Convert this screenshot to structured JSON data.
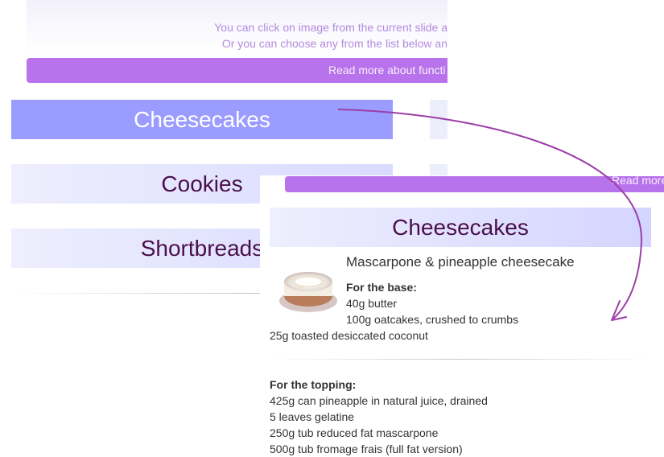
{
  "back_panel": {
    "intro_line1": "You can click on image from the current slide a",
    "intro_line2": "Or you can choose any from the list below an",
    "read_more": "Read more about functi",
    "categories": [
      "Cheesecakes",
      "Cookies",
      "Shortbreads"
    ]
  },
  "front_panel": {
    "read_more": "Read more abo",
    "category_title": "Cheesecakes",
    "recipe": {
      "title": "Mascarpone & pineapple cheesecake",
      "base_heading": "For the base:",
      "base_items": [
        "40g butter",
        "100g oatcakes, crushed to crumbs",
        "25g toasted desiccated coconut"
      ],
      "topping_heading": "For the topping:",
      "topping_items": [
        "425g can pineapple in natural juice, drained",
        "5 leaves gelatine",
        "250g tub reduced fat mascarpone",
        "500g tub fromage frais (full fat version)"
      ]
    }
  },
  "colors": {
    "accent_purple": "#b873ec",
    "active_category": "#9a9cff",
    "category_text": "#4a0f4a",
    "arrow": "#9b3fa6"
  }
}
